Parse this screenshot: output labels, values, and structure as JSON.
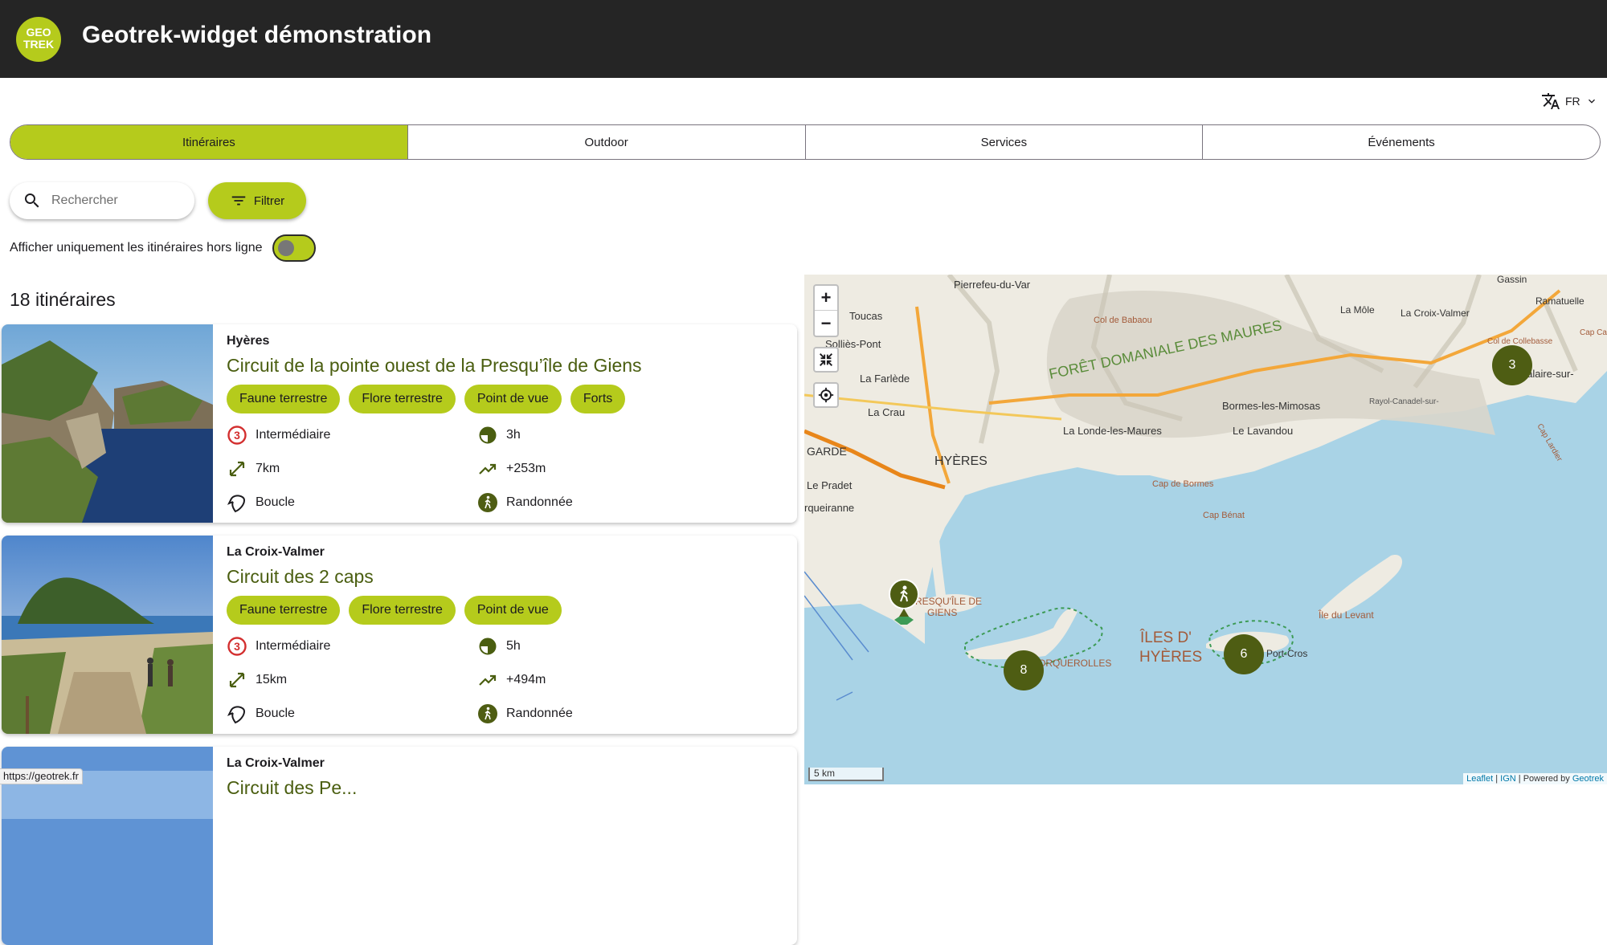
{
  "header": {
    "logo_line1": "GEO",
    "logo_line2": "TREK",
    "title": "Geotrek-widget démonstration"
  },
  "language": {
    "code": "FR"
  },
  "tabs": [
    {
      "label": "Itinéraires",
      "active": true
    },
    {
      "label": "Outdoor",
      "active": false
    },
    {
      "label": "Services",
      "active": false
    },
    {
      "label": "Événements",
      "active": false
    }
  ],
  "search": {
    "placeholder": "Rechercher",
    "value": ""
  },
  "filter": {
    "label": "Filtrer"
  },
  "offline": {
    "label": "Afficher uniquement les itinéraires hors ligne",
    "enabled": false
  },
  "results": {
    "count_label": "18 itinéraires"
  },
  "cards": [
    {
      "city": "Hyères",
      "title": "Circuit de la pointe ouest de la Presqu’île de Giens",
      "tags": [
        "Faune terrestre",
        "Flore terrestre",
        "Point de vue",
        "Forts"
      ],
      "difficulty": "Intermédiaire",
      "duration": "3h",
      "length": "7km",
      "ascent": "+253m",
      "route": "Boucle",
      "practice": "Randonnée"
    },
    {
      "city": "La Croix-Valmer",
      "title": "Circuit des 2 caps",
      "tags": [
        "Faune terrestre",
        "Flore terrestre",
        "Point de vue"
      ],
      "difficulty": "Intermédiaire",
      "duration": "5h",
      "length": "15km",
      "ascent": "+494m",
      "route": "Boucle",
      "practice": "Randonnée"
    },
    {
      "city": "La Croix-Valmer",
      "title": "Circuit des Pe..."
    }
  ],
  "status_url": "https://geotrek.fr",
  "map": {
    "place_labels": [
      "Pierrefeu-du-Var",
      "Toucas",
      "Solliès-Pont",
      "La Farlède",
      "La Crau",
      "GARDE",
      "HYÈRES",
      "Le Pradet",
      "rqueiranne",
      "FORÊT DOMANIALE DES MAURES",
      "Col de Babaou",
      "La Môle",
      "La Croix-Valmer",
      "Gassin",
      "Ramatuelle",
      "Cavalaire-sur-",
      "Bormes-les-Mimosas",
      "La Londe-les-Maures",
      "Le Lavandou",
      "Cap de Bormes",
      "Cap Bénat",
      "PRESQU'ÎLE DE GIENS",
      "ÎLES D' HYÈRES",
      "Île du Levant",
      "Port-Cros",
      "DE PORQUEROLLES",
      "Rayol-Canadel-sur-Mer",
      "Col de Collebasse",
      "Cap Lardier",
      "Cap Camarat"
    ],
    "clusters": [
      {
        "count": "3"
      },
      {
        "count": "8"
      },
      {
        "count": "6"
      }
    ],
    "scale_label": "5 km",
    "attribution": {
      "leaflet": "Leaflet",
      "ign": "IGN",
      "powered": "Powered by",
      "geotrek": "Geotrek"
    }
  },
  "colors": {
    "accent": "#b5cb1c",
    "header_bg": "#252525",
    "title_green": "#4a5e10",
    "cluster": "#4e5d13",
    "difficulty_red": "#d32f2f"
  }
}
